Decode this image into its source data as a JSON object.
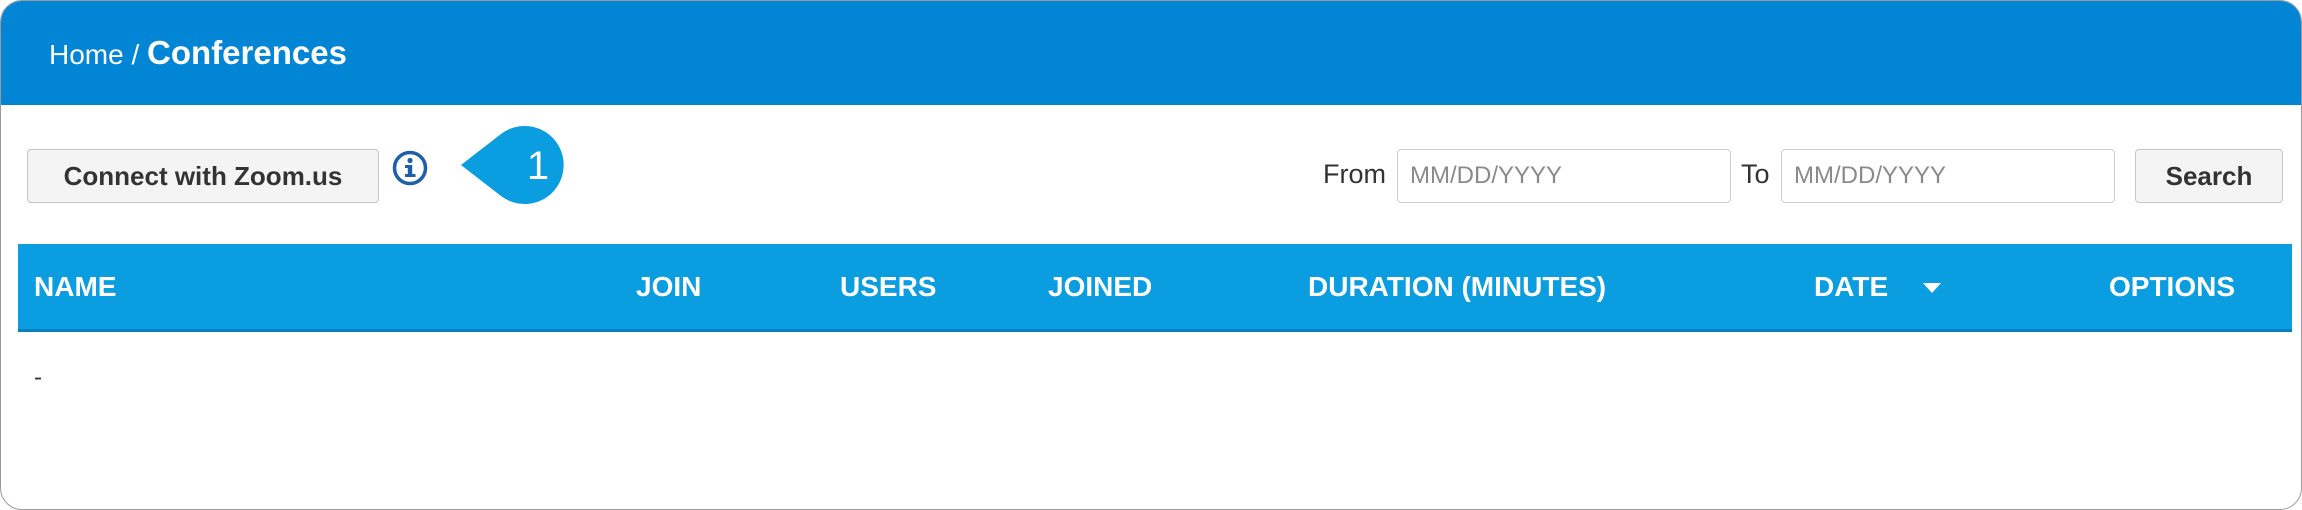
{
  "breadcrumb": {
    "home": "Home",
    "separator": "/",
    "current": "Conferences"
  },
  "toolbar": {
    "zoom_button": "Connect with Zoom.us",
    "callout_number": "1",
    "from_label": "From",
    "from_placeholder": "MM/DD/YYYY",
    "to_label": "To",
    "to_placeholder": "MM/DD/YYYY",
    "search_button": "Search"
  },
  "table": {
    "columns": [
      "NAME",
      "JOIN",
      "USERS",
      "JOINED",
      "DURATION (MINUTES)",
      "DATE",
      "OPTIONS"
    ],
    "sorted_column": "DATE",
    "sort_direction": "descending",
    "rows": [
      [
        "-"
      ]
    ]
  },
  "colors": {
    "header_bg": "#0385d6",
    "table_header_bg": "#0a9ddf",
    "callout": "#0a9ddf",
    "info_icon": "#1d5fa8"
  },
  "icons": {
    "info": "info-circle-icon",
    "sort": "caret-down-icon"
  }
}
